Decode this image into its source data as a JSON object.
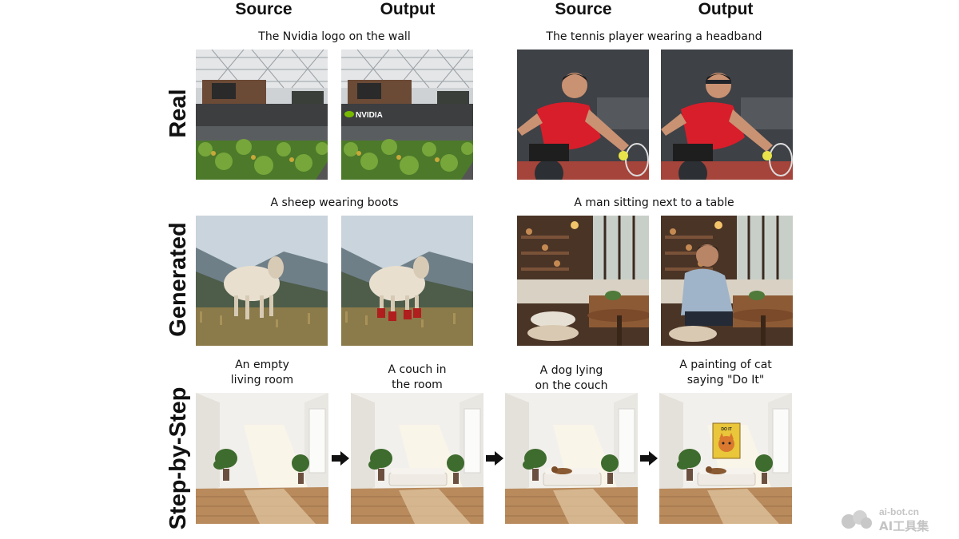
{
  "column_headers": [
    "Source",
    "Output",
    "Source",
    "Output"
  ],
  "row_labels": {
    "real": "Real",
    "generated": "Generated",
    "step": "Step-by-Step"
  },
  "captions": {
    "nvidia": "The Nvidia logo on the wall",
    "tennis": "The tennis player wearing a headband",
    "sheep": "A sheep wearing boots",
    "man_table": "A man sitting next to a table",
    "step1_line1": "An empty",
    "step1_line2": "living room",
    "step2_line1": "A couch in",
    "step2_line2": "the room",
    "step3_line1": "A dog lying",
    "step3_line2": "on the couch",
    "step4_line1": "A painting of cat",
    "step4_line2": "saying \"Do It\""
  },
  "in_image_text": {
    "nvidia_logo": "NVIDIA",
    "painting_text": "DO IT"
  },
  "watermark": {
    "line1": "ai-bot.cn",
    "line2": "AI工具集"
  },
  "icons": {
    "arrow": "right-arrow-icon",
    "watermark": "ai-bot-logo-icon"
  }
}
